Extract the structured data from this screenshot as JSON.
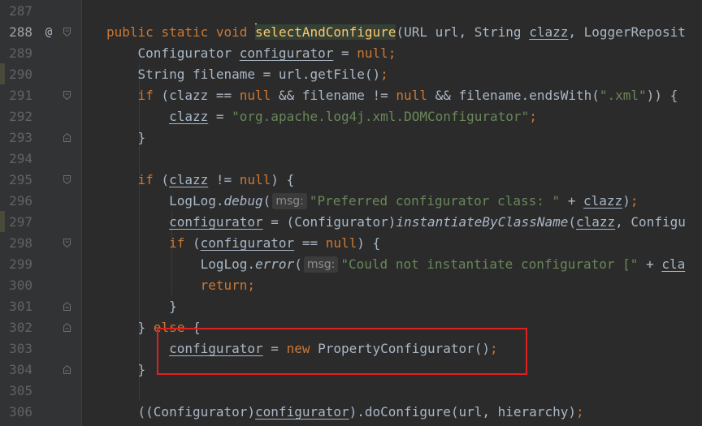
{
  "editor": {
    "lines": [
      {
        "num": "287",
        "segments": []
      },
      {
        "num": "288",
        "segments": [
          {
            "text": "public static void ",
            "cls": "kw"
          },
          {
            "text": "s",
            "cls": "fn hl-name",
            "caret": true
          },
          {
            "text": "electAndConfigure",
            "cls": "fn hl-name"
          },
          {
            "text": "(URL url, String ",
            "cls": ""
          },
          {
            "text": "clazz",
            "cls": "ul"
          },
          {
            "text": ", LoggerReposit",
            "cls": ""
          }
        ]
      },
      {
        "num": "289",
        "segments": [
          {
            "text": "    Configurator ",
            "cls": ""
          },
          {
            "text": "configurator",
            "cls": "ul"
          },
          {
            "text": " = ",
            "cls": ""
          },
          {
            "text": "null",
            "cls": "kw"
          },
          {
            "text": ";",
            "cls": "kw"
          }
        ]
      },
      {
        "num": "290",
        "segments": [
          {
            "text": "    String filename = url.getFile()",
            "cls": ""
          },
          {
            "text": ";",
            "cls": "kw"
          }
        ]
      },
      {
        "num": "291",
        "segments": [
          {
            "text": "    ",
            "cls": ""
          },
          {
            "text": "if",
            "cls": "kw"
          },
          {
            "text": " (clazz == ",
            "cls": ""
          },
          {
            "text": "null",
            "cls": "kw"
          },
          {
            "text": " && filename != ",
            "cls": ""
          },
          {
            "text": "null",
            "cls": "kw"
          },
          {
            "text": " && filename.endsWith(",
            "cls": ""
          },
          {
            "text": "\".xml\"",
            "cls": "str"
          },
          {
            "text": ")) {",
            "cls": ""
          }
        ]
      },
      {
        "num": "292",
        "segments": [
          {
            "text": "        ",
            "cls": ""
          },
          {
            "text": "clazz",
            "cls": "ul"
          },
          {
            "text": " = ",
            "cls": ""
          },
          {
            "text": "\"org.apache.log4j.xml.DOMConfigurator\"",
            "cls": "str"
          },
          {
            "text": ";",
            "cls": "kw"
          }
        ]
      },
      {
        "num": "293",
        "segments": [
          {
            "text": "    }",
            "cls": ""
          }
        ]
      },
      {
        "num": "294",
        "segments": []
      },
      {
        "num": "295",
        "segments": [
          {
            "text": "    ",
            "cls": ""
          },
          {
            "text": "if",
            "cls": "kw"
          },
          {
            "text": " (",
            "cls": ""
          },
          {
            "text": "clazz",
            "cls": "ul"
          },
          {
            "text": " != ",
            "cls": ""
          },
          {
            "text": "null",
            "cls": "kw"
          },
          {
            "text": ") {",
            "cls": ""
          }
        ]
      },
      {
        "num": "296",
        "segments": [
          {
            "text": "        LogLog.",
            "cls": ""
          },
          {
            "text": "debug",
            "cls": "it"
          },
          {
            "text": "(",
            "cls": ""
          },
          {
            "hint": "msg:"
          },
          {
            "text": "\"Preferred configurator class: \"",
            "cls": "str"
          },
          {
            "text": " + ",
            "cls": ""
          },
          {
            "text": "clazz",
            "cls": "ul"
          },
          {
            "text": ")",
            "cls": ""
          },
          {
            "text": ";",
            "cls": "kw"
          }
        ]
      },
      {
        "num": "297",
        "segments": [
          {
            "text": "        ",
            "cls": ""
          },
          {
            "text": "configurator",
            "cls": "ul"
          },
          {
            "text": " = (Configurator)",
            "cls": ""
          },
          {
            "text": "instantiateByClassName",
            "cls": "it"
          },
          {
            "text": "(",
            "cls": ""
          },
          {
            "text": "clazz",
            "cls": "ul"
          },
          {
            "text": ", Configu",
            "cls": ""
          }
        ]
      },
      {
        "num": "298",
        "segments": [
          {
            "text": "        ",
            "cls": ""
          },
          {
            "text": "if",
            "cls": "kw"
          },
          {
            "text": " (",
            "cls": ""
          },
          {
            "text": "configurator",
            "cls": "ul"
          },
          {
            "text": " == ",
            "cls": ""
          },
          {
            "text": "null",
            "cls": "kw"
          },
          {
            "text": ") {",
            "cls": ""
          }
        ]
      },
      {
        "num": "299",
        "segments": [
          {
            "text": "            LogLog.",
            "cls": ""
          },
          {
            "text": "error",
            "cls": "it"
          },
          {
            "text": "(",
            "cls": ""
          },
          {
            "hint": "msg:"
          },
          {
            "text": "\"Could not instantiate configurator [\"",
            "cls": "str"
          },
          {
            "text": " + ",
            "cls": ""
          },
          {
            "text": "cla",
            "cls": "ul"
          }
        ]
      },
      {
        "num": "300",
        "segments": [
          {
            "text": "            ",
            "cls": ""
          },
          {
            "text": "return",
            "cls": "kw"
          },
          {
            "text": ";",
            "cls": "kw"
          }
        ]
      },
      {
        "num": "301",
        "segments": [
          {
            "text": "        }",
            "cls": ""
          }
        ]
      },
      {
        "num": "302",
        "segments": [
          {
            "text": "    } ",
            "cls": ""
          },
          {
            "text": "else",
            "cls": "kw"
          },
          {
            "text": " {",
            "cls": ""
          }
        ]
      },
      {
        "num": "303",
        "segments": [
          {
            "text": "        ",
            "cls": ""
          },
          {
            "text": "configurator",
            "cls": "ul"
          },
          {
            "text": " = ",
            "cls": ""
          },
          {
            "text": "new",
            "cls": "kw"
          },
          {
            "text": " PropertyConfigurator()",
            "cls": ""
          },
          {
            "text": ";",
            "cls": "kw"
          }
        ]
      },
      {
        "num": "304",
        "segments": [
          {
            "text": "    }",
            "cls": ""
          }
        ]
      },
      {
        "num": "305",
        "segments": []
      },
      {
        "num": "306",
        "segments": [
          {
            "text": "    ((Configurator)",
            "cls": ""
          },
          {
            "text": "configurator",
            "cls": "ul"
          },
          {
            "text": ").doConfigure(url, hierarchy)",
            "cls": ""
          },
          {
            "text": ";",
            "cls": "kw"
          }
        ]
      }
    ],
    "annotation_symbol": "@",
    "annotation_line": "288",
    "current_line": "288",
    "fold_open_lines": [
      "288",
      "291",
      "295",
      "298"
    ],
    "fold_close_lines": [
      "293",
      "301",
      "302",
      "304"
    ]
  },
  "colors": {
    "background": "#2b2b2b",
    "gutter": "#313335",
    "keyword": "#cc7832",
    "method_decl": "#ffc66d",
    "string": "#6a8759",
    "default_text": "#a9b7c6",
    "line_number": "#606366",
    "highlight_box": "#e02020"
  }
}
